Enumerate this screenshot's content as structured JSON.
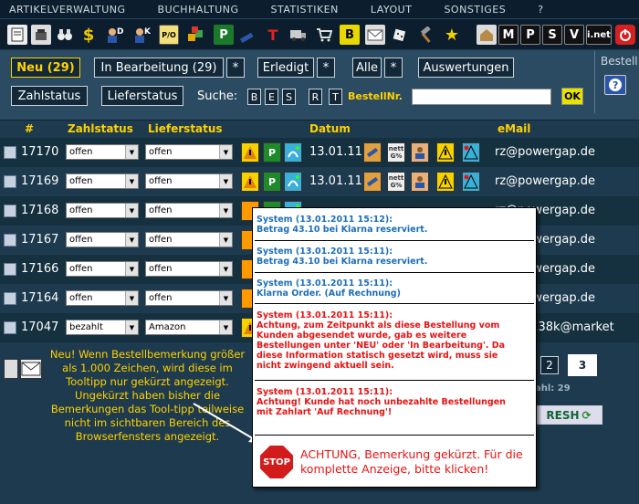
{
  "menu": [
    "ARTIKELVERWALTUNG",
    "BUCHHALTUNG",
    "STATISTIKEN",
    "LAYOUT",
    "SONSTIGES",
    "?"
  ],
  "iconbar_right": {
    "m": "M",
    "p": "P",
    "s": "S",
    "v": "V",
    "inet": "i.net"
  },
  "iconbar_letters": {
    "p": "P",
    "t": "T",
    "b": "B",
    "po": "P/O"
  },
  "toolbar": {
    "neu": "Neu (29)",
    "bearbeitung": "In Bearbeitung (29)",
    "star": "*",
    "erledigt": "Erledigt",
    "alle": "Alle",
    "auswertungen": "Auswertungen",
    "bestell": "Bestell",
    "zahlstatus": "Zahlstatus",
    "lieferstatus": "Lieferstatus",
    "suche": "Suche:",
    "search_letters": [
      "B",
      "E",
      "S",
      "R",
      "T"
    ],
    "bestellnr": "BestellNr.",
    "ok": "OK"
  },
  "columns": {
    "num": "#",
    "zahlstatus": "Zahlstatus",
    "lieferstatus": "Lieferstatus",
    "datum": "Datum",
    "email": "eMail"
  },
  "rows": [
    {
      "id": "17170",
      "zahl": "offen",
      "liefer": "offen",
      "date": "13.01.11",
      "email": "rz@powergap.de"
    },
    {
      "id": "17169",
      "zahl": "offen",
      "liefer": "offen",
      "date": "13.01.11",
      "email": "rz@powergap.de"
    },
    {
      "id": "17168",
      "zahl": "offen",
      "liefer": "offen",
      "date": "",
      "email": "rz@powergap.de"
    },
    {
      "id": "17167",
      "zahl": "offen",
      "liefer": "offen",
      "date": "",
      "email": "rz@powergap.de"
    },
    {
      "id": "17166",
      "zahl": "offen",
      "liefer": "offen",
      "date": "",
      "email": "rz@powergap.de"
    },
    {
      "id": "17164",
      "zahl": "offen",
      "liefer": "offen",
      "date": "",
      "email": "rz@powergap.de"
    },
    {
      "id": "17047",
      "zahl": "bezahlt",
      "liefer": "Amazon",
      "date": "",
      "email": "ywdm138k@market"
    }
  ],
  "icon_labels": {
    "p": "P",
    "nett": "nett G%"
  },
  "tooltip": {
    "entries": [
      {
        "head": "System (13.01.2011 15:12):",
        "body": "Betrag 43.10 bei Klarna reserviert."
      },
      {
        "head": "System (13.01.2011 15:11):",
        "body": "Betrag 43.10 bei Klarna reserviert."
      },
      {
        "head": "System (13.01.2011 15:11):",
        "body": "Klarna Order. (Auf Rechnung)"
      },
      {
        "head": "System (13.01.2011 15:11):",
        "body": "Achtung, zum Zeitpunkt als diese Bestellung vom Kunden abgesendet wurde, gab es weitere Bestellungen unter 'NEU' oder 'In Bearbeitung'. Da diese Information statisch gesetzt wird, muss sie nicht zwingend aktuell sein."
      },
      {
        "head": "System (13.01.2011 15:11):",
        "body": "Achtung! Kunde hat noch unbezahlte Bestellungen mit Zahlart 'Auf Rechnung'!"
      }
    ],
    "stop": "STOP",
    "warning": "ACHTUNG, Bemerkung gekürzt. Für die komplette Anzeige, bitte klicken!"
  },
  "note": "Neu! Wenn Bestellbemerkung größer als 1.000 Zeichen, wird diese im Tooltipp nur gekürzt angezeigt. Ungekürzt haben bisher die Bemerkungen das Tool-tipp teilweise nicht im sichtbaren Bereich des Browserfensters angezeigt.",
  "pagination": {
    "p2": "2",
    "p3": "3",
    "zahl": "ahl: 29",
    "refresh": "RESH"
  },
  "colors": {
    "accent": "#ffd200",
    "bg": "#1e3a4e",
    "tooltip_blue": "#1c6fb8",
    "tooltip_red": "#e81313"
  }
}
